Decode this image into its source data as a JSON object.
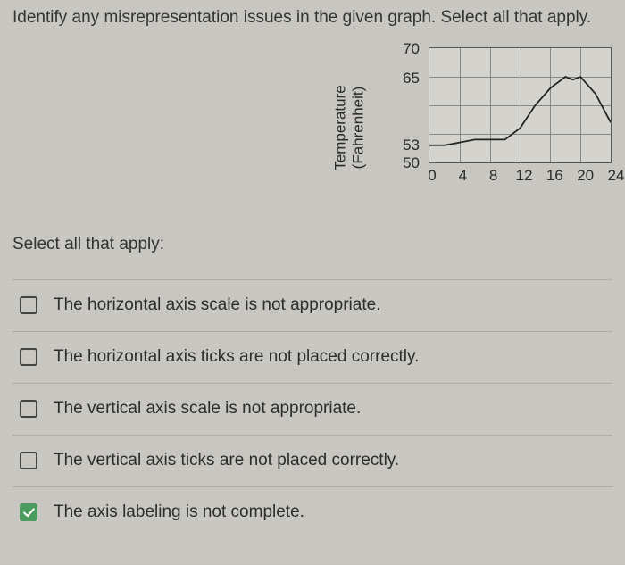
{
  "question": "Identify any misrepresentation issues in the given graph. Select all that apply.",
  "instructions": "Select all that apply:",
  "chart_data": {
    "type": "line",
    "ylabel_line1": "Temperature",
    "ylabel_line2": "(Fahrenheit)",
    "xticks": [
      "0",
      "4",
      "8",
      "12",
      "16",
      "20",
      "24"
    ],
    "yticks": [
      {
        "label": "70",
        "value": 70
      },
      {
        "label": "65",
        "value": 65
      },
      {
        "label": "53",
        "value": 53
      },
      {
        "label": "50",
        "value": 50
      }
    ],
    "ylim": [
      50,
      70
    ],
    "xlim": [
      0,
      24
    ],
    "x": [
      0,
      2,
      4,
      6,
      8,
      10,
      12,
      14,
      16,
      18,
      19,
      20,
      22,
      24
    ],
    "y": [
      53,
      53,
      53.5,
      54,
      54,
      54,
      56,
      60,
      63,
      65,
      64.5,
      65,
      62,
      57
    ]
  },
  "options": [
    {
      "label": "The horizontal axis scale is not appropriate.",
      "checked": false
    },
    {
      "label": "The horizontal axis ticks are not placed correctly.",
      "checked": false
    },
    {
      "label": "The vertical axis scale is not appropriate.",
      "checked": false
    },
    {
      "label": "The vertical axis ticks are not placed correctly.",
      "checked": false
    },
    {
      "label": "The axis labeling is not complete.",
      "checked": true
    }
  ]
}
